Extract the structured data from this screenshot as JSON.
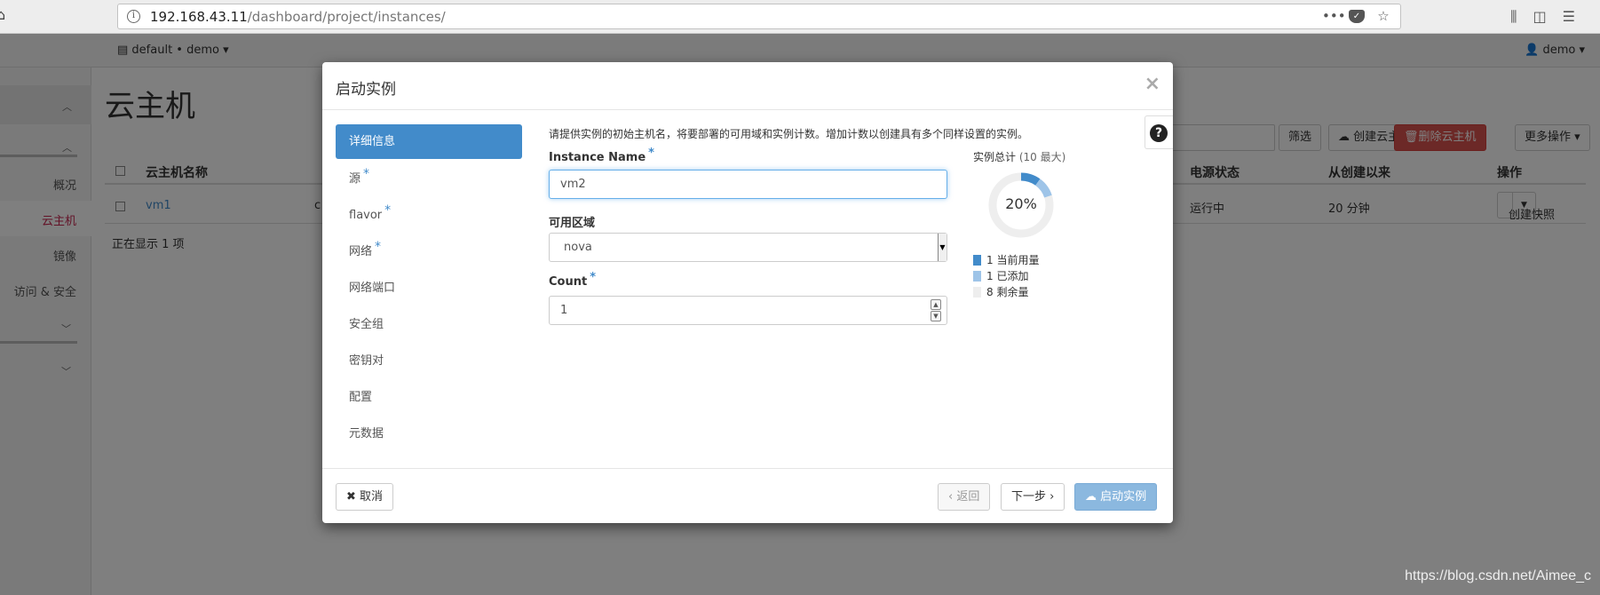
{
  "browser": {
    "url_host": "192.168.43.11",
    "url_path": "/dashboard/project/instances/"
  },
  "header": {
    "project": "default • demo",
    "user": "demo"
  },
  "sidebar": {
    "items": [
      {
        "label": "概况"
      },
      {
        "label": "云主机"
      },
      {
        "label": "镜像"
      },
      {
        "label": "访问 & 安全"
      }
    ]
  },
  "page": {
    "title": "云主机",
    "toolbar": {
      "filter": "筛选",
      "create": "创建云主机",
      "delete": "删除云主机",
      "more": "更多操作"
    },
    "table": {
      "columns": [
        "云主机名称",
        "电源状态",
        "从创建以来",
        "操作"
      ],
      "rows": [
        {
          "name": "vm1",
          "col2_fragment": "c",
          "power": "运行中",
          "age": "20 分钟",
          "action": "创建快照"
        }
      ],
      "footer": "正在显示 1 项"
    }
  },
  "modal": {
    "title": "启动实例",
    "close": "×",
    "help": "?",
    "nav": [
      {
        "label": "详细信息",
        "required": false
      },
      {
        "label": "源",
        "required": true
      },
      {
        "label": "flavor",
        "required": true
      },
      {
        "label": "网络",
        "required": true
      },
      {
        "label": "网络端口",
        "required": false
      },
      {
        "label": "安全组",
        "required": false
      },
      {
        "label": "密钥对",
        "required": false
      },
      {
        "label": "配置",
        "required": false
      },
      {
        "label": "元数据",
        "required": false
      }
    ],
    "required_mark": "*",
    "description": "请提供实例的初始主机名，将要部署的可用域和实例计数。增加计数以创建具有多个同样设置的实例。",
    "fields": {
      "instance_name": {
        "label": "Instance Name",
        "value": "vm2"
      },
      "availability_zone": {
        "label": "可用区域",
        "value": "nova"
      },
      "count": {
        "label": "Count",
        "value": "1"
      }
    },
    "quota": {
      "title": "实例总计",
      "max": "(10 最大)",
      "percent_label": "20%",
      "current_fraction": 0.1,
      "added_fraction": 0.1,
      "legend": [
        {
          "label": "1 当前用量",
          "color": "#428bca"
        },
        {
          "label": "1 已添加",
          "color": "#9ec4e8"
        },
        {
          "label": "8 剩余量",
          "color": "#eeeeee"
        }
      ]
    },
    "footer": {
      "cancel": "取消",
      "back": "‹ 返回",
      "next": "下一步 ›",
      "launch": "启动实例"
    }
  },
  "watermark": "https://blog.csdn.net/Aimee_c"
}
